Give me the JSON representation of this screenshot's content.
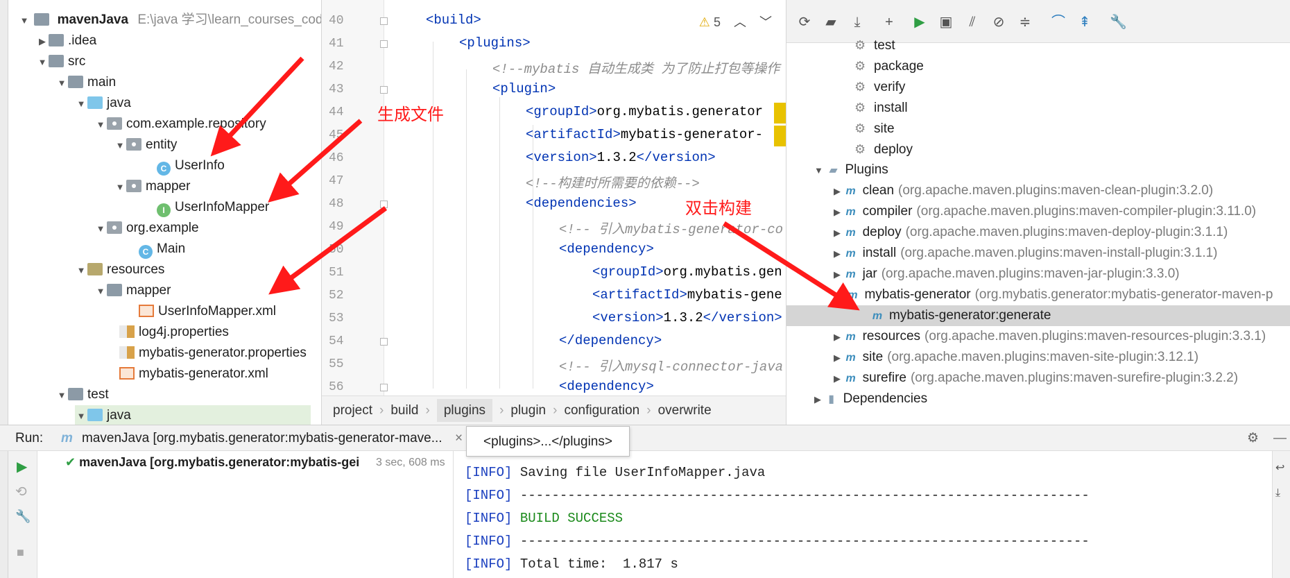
{
  "project_tree": {
    "root_name": "mavenJava",
    "root_path": "E:\\java 学习\\learn_courses_code\\r",
    "items": [
      {
        "label": ".idea"
      },
      {
        "label": "src"
      },
      {
        "label": "main"
      },
      {
        "label": "java"
      },
      {
        "label": "com.example.repository"
      },
      {
        "label": "entity"
      },
      {
        "label": "UserInfo"
      },
      {
        "label": "mapper"
      },
      {
        "label": "UserInfoMapper"
      },
      {
        "label": "org.example"
      },
      {
        "label": "Main"
      },
      {
        "label": "resources"
      },
      {
        "label": "mapper"
      },
      {
        "label": "UserInfoMapper.xml"
      },
      {
        "label": "log4j.properties"
      },
      {
        "label": "mybatis-generator.properties"
      },
      {
        "label": "mybatis-generator.xml"
      },
      {
        "label": "test"
      },
      {
        "label": "java"
      }
    ]
  },
  "editor": {
    "warning_count": "5",
    "line_numbers": [
      "40",
      "41",
      "42",
      "43",
      "44",
      "45",
      "46",
      "47",
      "48",
      "49",
      "50",
      "51",
      "52",
      "53",
      "54",
      "55",
      "56"
    ],
    "lines": [
      {
        "open": "<",
        "tag": "build",
        "close": ">"
      },
      {
        "open": "<",
        "tag": "plugins",
        "close": ">"
      },
      {
        "comment": "<!--mybatis 自动生成类 为了防止打包等操作"
      },
      {
        "open": "<",
        "tag": "plugin",
        "close": ">"
      },
      {
        "open": "<",
        "tag": "groupId",
        "close": ">",
        "text": "org.mybatis.generator"
      },
      {
        "open": "<",
        "tag": "artifactId",
        "close": ">",
        "text": "mybatis-generator-"
      },
      {
        "open": "<",
        "tag": "version",
        "close": ">",
        "text": "1.3.2",
        "end_open": "</",
        "end_tag": "version",
        "end_close": ">"
      },
      {
        "comment": "<!--构建时所需要的依赖-->"
      },
      {
        "open": "<",
        "tag": "dependencies",
        "close": ">"
      },
      {
        "comment": "<!-- 引入mybatis-generator-co"
      },
      {
        "open": "<",
        "tag": "dependency",
        "close": ">"
      },
      {
        "open": "<",
        "tag": "groupId",
        "close": ">",
        "text": "org.mybatis.gen"
      },
      {
        "open": "<",
        "tag": "artifactId",
        "close": ">",
        "text": "mybatis-gene"
      },
      {
        "open": "<",
        "tag": "version",
        "close": ">",
        "text": "1.3.2",
        "end_open": "</",
        "end_tag": "version",
        "end_close": ">"
      },
      {
        "open": "</",
        "tag": "dependency",
        "close": ">"
      },
      {
        "comment": "<!-- 引入mysql-connector-java"
      },
      {
        "open": "<",
        "tag": "dependency",
        "close": ">"
      }
    ],
    "breadcrumb": [
      "project",
      "build",
      "plugins",
      "plugin",
      "configuration",
      "overwrite"
    ]
  },
  "maven": {
    "lifecycle": [
      "test",
      "package",
      "verify",
      "install",
      "site",
      "deploy"
    ],
    "plugins_label": "Plugins",
    "plugins": [
      {
        "name": "clean",
        "coords": "(org.apache.maven.plugins:maven-clean-plugin:3.2.0)"
      },
      {
        "name": "compiler",
        "coords": "(org.apache.maven.plugins:maven-compiler-plugin:3.11.0)"
      },
      {
        "name": "deploy",
        "coords": "(org.apache.maven.plugins:maven-deploy-plugin:3.1.1)"
      },
      {
        "name": "install",
        "coords": "(org.apache.maven.plugins:maven-install-plugin:3.1.1)"
      },
      {
        "name": "jar",
        "coords": "(org.apache.maven.plugins:maven-jar-plugin:3.3.0)"
      },
      {
        "name": "mybatis-generator",
        "coords": "(org.mybatis.generator:mybatis-generator-maven-p"
      },
      {
        "name": "resources",
        "coords": "(org.apache.maven.plugins:maven-resources-plugin:3.3.1)"
      },
      {
        "name": "site",
        "coords": "(org.apache.maven.plugins:maven-site-plugin:3.12.1)"
      },
      {
        "name": "surefire",
        "coords": "(org.apache.maven.plugins:maven-surefire-plugin:3.2.2)"
      }
    ],
    "goal": "mybatis-generator:generate",
    "dependencies_label": "Dependencies"
  },
  "annotations": {
    "generate_files": "生成文件",
    "double_click": "双击构建"
  },
  "run": {
    "label": "Run:",
    "tab_label": "mavenJava [org.mybatis.generator:mybatis-generator-mave...",
    "tooltip": "<plugins>...</plugins>",
    "tree_item": "mavenJava [org.mybatis.generator:mybatis-gei",
    "duration": "3 sec, 608 ms",
    "console": [
      {
        "prefix": "[INFO]",
        "text": " Saving file UserInfoMapper.java"
      },
      {
        "prefix": "[INFO]",
        "text": " ------------------------------------------------------------------------"
      },
      {
        "prefix": "[INFO]",
        "text": " BUILD SUCCESS",
        "green": true
      },
      {
        "prefix": "[INFO]",
        "text": " ------------------------------------------------------------------------"
      },
      {
        "prefix": "[INFO]",
        "text": " Total time:  1.817 s"
      }
    ]
  },
  "colors": {
    "annotation": "#ff1a1a",
    "selection": "#d5d5d5",
    "tag": "#0033b3"
  }
}
